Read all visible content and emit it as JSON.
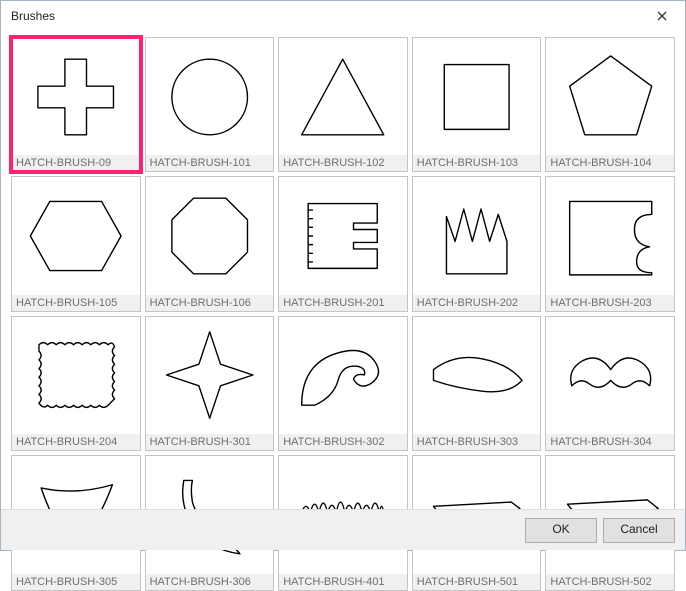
{
  "window": {
    "title": "Brushes"
  },
  "footer": {
    "ok_label": "OK",
    "cancel_label": "Cancel"
  },
  "selected_index": 0,
  "brushes": {
    "items": [
      {
        "label": "HATCH-BRUSH-09",
        "icon": "plus"
      },
      {
        "label": "HATCH-BRUSH-101",
        "icon": "circle"
      },
      {
        "label": "HATCH-BRUSH-102",
        "icon": "triangle"
      },
      {
        "label": "HATCH-BRUSH-103",
        "icon": "square"
      },
      {
        "label": "HATCH-BRUSH-104",
        "icon": "pentagon"
      },
      {
        "label": "HATCH-BRUSH-105",
        "icon": "hexagon"
      },
      {
        "label": "HATCH-BRUSH-106",
        "icon": "octagon"
      },
      {
        "label": "HATCH-BRUSH-201",
        "icon": "ticket"
      },
      {
        "label": "HATCH-BRUSH-202",
        "icon": "grass"
      },
      {
        "label": "HATCH-BRUSH-203",
        "icon": "bite"
      },
      {
        "label": "HATCH-BRUSH-204",
        "icon": "stamp"
      },
      {
        "label": "HATCH-BRUSH-301",
        "icon": "star4"
      },
      {
        "label": "HATCH-BRUSH-302",
        "icon": "swirl"
      },
      {
        "label": "HATCH-BRUSH-303",
        "icon": "smear"
      },
      {
        "label": "HATCH-BRUSH-304",
        "icon": "moustache"
      },
      {
        "label": "HATCH-BRUSH-305",
        "icon": "fan"
      },
      {
        "label": "HATCH-BRUSH-306",
        "icon": "tail"
      },
      {
        "label": "HATCH-BRUSH-401",
        "icon": "flames"
      },
      {
        "label": "HATCH-BRUSH-501",
        "icon": "stroke1"
      },
      {
        "label": "HATCH-BRUSH-502",
        "icon": "stroke2"
      }
    ]
  }
}
